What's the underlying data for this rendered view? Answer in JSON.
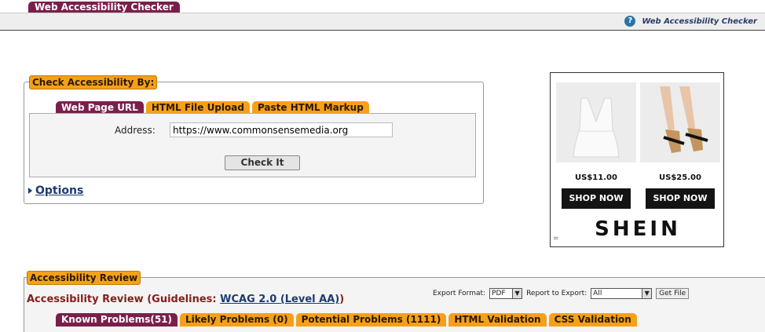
{
  "header": {
    "tab_title": "Web Accessibility Checker",
    "help_label": "Web Accessibility Checker",
    "help_icon": "question-icon"
  },
  "check": {
    "legend": "Check Accessibility By:",
    "tabs": [
      "Web Page URL",
      "HTML File Upload",
      "Paste HTML Markup"
    ],
    "address_label": "Address:",
    "address_value": "https://www.commonsensemedia.org",
    "check_button": "Check It",
    "options_link": "Options"
  },
  "ad": {
    "products": [
      {
        "price": "US$11.00",
        "cta": "SHOP NOW"
      },
      {
        "price": "US$25.00",
        "cta": "SHOP NOW"
      }
    ],
    "brand": "SHEIN",
    "tag": "="
  },
  "review": {
    "legend": "Accessibility Review",
    "title_prefix": "Accessibility Review (Guidelines: ",
    "guideline_link": "WCAG 2.0 (Level AA)",
    "title_suffix": ")",
    "export_format_label": "Export Format:",
    "export_format_value": "PDF",
    "report_label": "Report to Export:",
    "report_value": "All",
    "get_file": "Get File",
    "tabs": [
      "Known Problems(51)",
      "Likely Problems (0)",
      "Potential Problems (1111)",
      "HTML Validation",
      "CSS Validation"
    ]
  },
  "colors": {
    "tab_active": "#7a1f4c",
    "tab_inactive": "#f6a01a",
    "link": "#1d3b70",
    "title_red": "#8a1c1c"
  }
}
